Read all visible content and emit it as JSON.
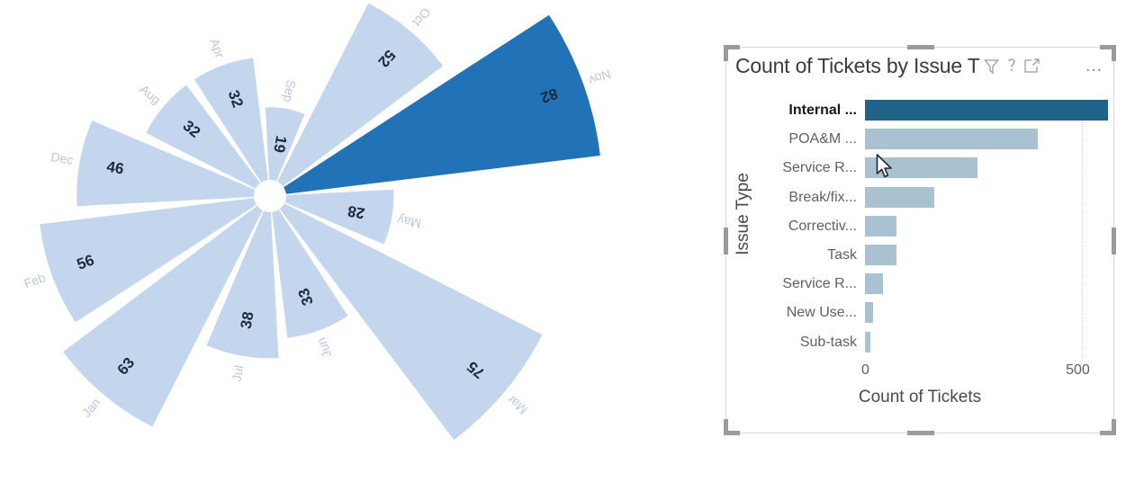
{
  "chart_data": [
    {
      "type": "pie",
      "variant": "radial-bar-rose",
      "title": "",
      "categories": [
        "Nov",
        "Oct",
        "Sep",
        "Apr",
        "Aug",
        "Dec",
        "Feb",
        "Jan",
        "Jul",
        "Jun",
        "Mar",
        "May"
      ],
      "values": [
        82,
        52,
        19,
        32,
        32,
        46,
        56,
        63,
        38,
        33,
        75,
        28
      ],
      "highlighted": "Nov",
      "highlight_color": "#2272B8",
      "base_color": "#C3D6EE",
      "label_color": "#B9C8DD",
      "value_color": "#1D2A3A",
      "legend": "none",
      "grid": false
    },
    {
      "type": "bar",
      "orientation": "horizontal",
      "title": "Count of Tickets by Issue T",
      "xlabel": "Count of Tickets",
      "ylabel": "Issue Type",
      "xlim": [
        0,
        560
      ],
      "xticks": [
        "0",
        "500"
      ],
      "xtick_values": [
        0,
        500
      ],
      "grid": true,
      "categories": [
        "Internal ...",
        "POA&M ...",
        "Service R...",
        "Break/fix...",
        "Correctiv...",
        "Task",
        "Service R...",
        "New Use...",
        "Sub-task"
      ],
      "values": [
        560,
        398,
        260,
        160,
        72,
        72,
        42,
        18,
        12
      ],
      "selected_index": 0,
      "selected_color": "#1F6389",
      "bar_color": "#A9C2D2"
    }
  ],
  "rose": {
    "sectors": [
      {
        "label": "Nov",
        "value": "82"
      },
      {
        "label": "Oct",
        "value": "52"
      },
      {
        "label": "Sep",
        "value": "19"
      },
      {
        "label": "Apr",
        "value": "32"
      },
      {
        "label": "Aug",
        "value": "32"
      },
      {
        "label": "Dec",
        "value": "46"
      },
      {
        "label": "Feb",
        "value": "56"
      },
      {
        "label": "Jan",
        "value": "63"
      },
      {
        "label": "Jul",
        "value": "38"
      },
      {
        "label": "Jun",
        "value": "33"
      },
      {
        "label": "Mar",
        "value": "75"
      },
      {
        "label": "May",
        "value": "28"
      }
    ]
  },
  "bar_panel": {
    "title": "Count of Tickets by Issue T",
    "icons": {
      "filter": "filter-icon",
      "help": "question-mark-icon",
      "focus": "focus-mode-icon",
      "more": "…"
    },
    "y_axis_title": "Issue Type",
    "x_axis_title": "Count of Tickets",
    "x_ticks": [
      "0",
      "500"
    ],
    "rows": [
      {
        "label": "Internal ...",
        "value": 560
      },
      {
        "label": "POA&M ...",
        "value": 398
      },
      {
        "label": "Service R...",
        "value": 260
      },
      {
        "label": "Break/fix...",
        "value": 160
      },
      {
        "label": "Correctiv...",
        "value": 72
      },
      {
        "label": "Task",
        "value": 72
      },
      {
        "label": "Service R...",
        "value": 42
      },
      {
        "label": "New Use...",
        "value": 18
      },
      {
        "label": "Sub-task",
        "value": 12
      }
    ]
  }
}
